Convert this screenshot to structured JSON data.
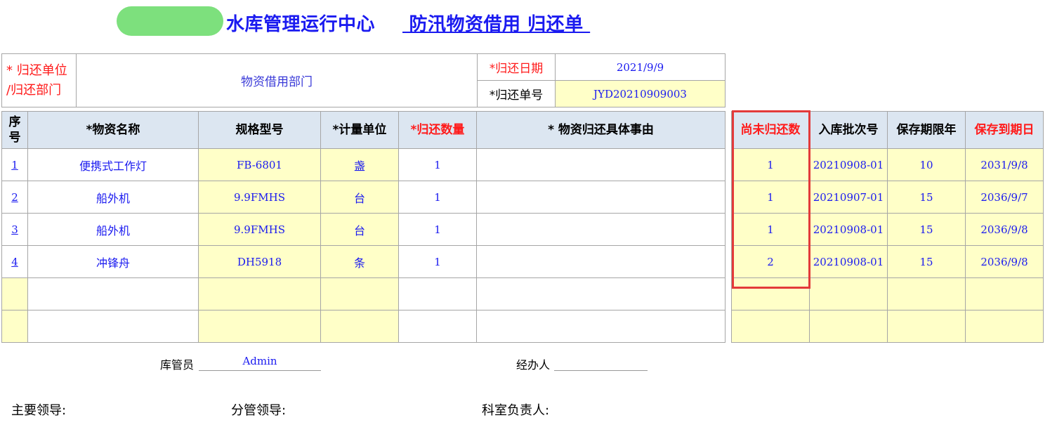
{
  "title": {
    "main": "水库管理运行中心",
    "sub": " 防汛物资借用 归还单 "
  },
  "info": {
    "unit_label_line1": "* 归还单位",
    "unit_label_line2": "/归还部门",
    "unit_value": "物资借用部门",
    "date_label": "*归还日期",
    "date_value": "2021/9/9",
    "order_label": "*归还单号",
    "order_value": "JYD20210909003"
  },
  "main_table": {
    "headers": {
      "seq_1": "序",
      "seq_2": "号",
      "name": "*物资名称",
      "spec": "规格型号",
      "unit": "*计量单位",
      "qty": "*归还数量",
      "reason": "* 物资归还具体事由"
    },
    "rows": [
      {
        "seq": "1",
        "name": "便携式工作灯",
        "spec": "FB-6801",
        "unit": "盏",
        "qty": "1",
        "reason": ""
      },
      {
        "seq": "2",
        "name": "船外机",
        "spec": "9.9FMHS",
        "unit": "台",
        "qty": "1",
        "reason": ""
      },
      {
        "seq": "3",
        "name": "船外机",
        "spec": "9.9FMHS",
        "unit": "台",
        "qty": "1",
        "reason": ""
      },
      {
        "seq": "4",
        "name": "冲锋舟",
        "spec": "DH5918",
        "unit": "条",
        "qty": "1",
        "reason": ""
      },
      {
        "seq": "",
        "name": "",
        "spec": "",
        "unit": "",
        "qty": "",
        "reason": ""
      },
      {
        "seq": "",
        "name": "",
        "spec": "",
        "unit": "",
        "qty": "",
        "reason": ""
      }
    ]
  },
  "side_table": {
    "headers": {
      "pending": "尚未归还数",
      "batch": "入库批次号",
      "years": "保存期限年",
      "expiry": "保存到期日"
    },
    "rows": [
      {
        "pending": "1",
        "batch": "20210908-01",
        "years": "10",
        "expiry": "2031/9/8"
      },
      {
        "pending": "1",
        "batch": "20210907-01",
        "years": "15",
        "expiry": "2036/9/7"
      },
      {
        "pending": "1",
        "batch": "20210908-01",
        "years": "15",
        "expiry": "2036/9/8"
      },
      {
        "pending": "2",
        "batch": "20210908-01",
        "years": "15",
        "expiry": "2036/9/8"
      },
      {
        "pending": "",
        "batch": "",
        "years": "",
        "expiry": ""
      },
      {
        "pending": "",
        "batch": "",
        "years": "",
        "expiry": ""
      }
    ]
  },
  "signatures": {
    "keeper_label": "库管员",
    "keeper_value": "Admin",
    "handler_label": "经办人",
    "handler_value": "",
    "leader_label": "主要领导:",
    "deputy_label": "分管领导:",
    "section_label": "科室负责人:"
  },
  "colors": {
    "accent_blue": "#1a1af0",
    "required_red": "#ff1a1a",
    "header_bg": "#dce6f1",
    "cell_yellow": "#ffffc8",
    "highlight_border": "#e33a3a",
    "redaction_green": "#7de07d"
  }
}
